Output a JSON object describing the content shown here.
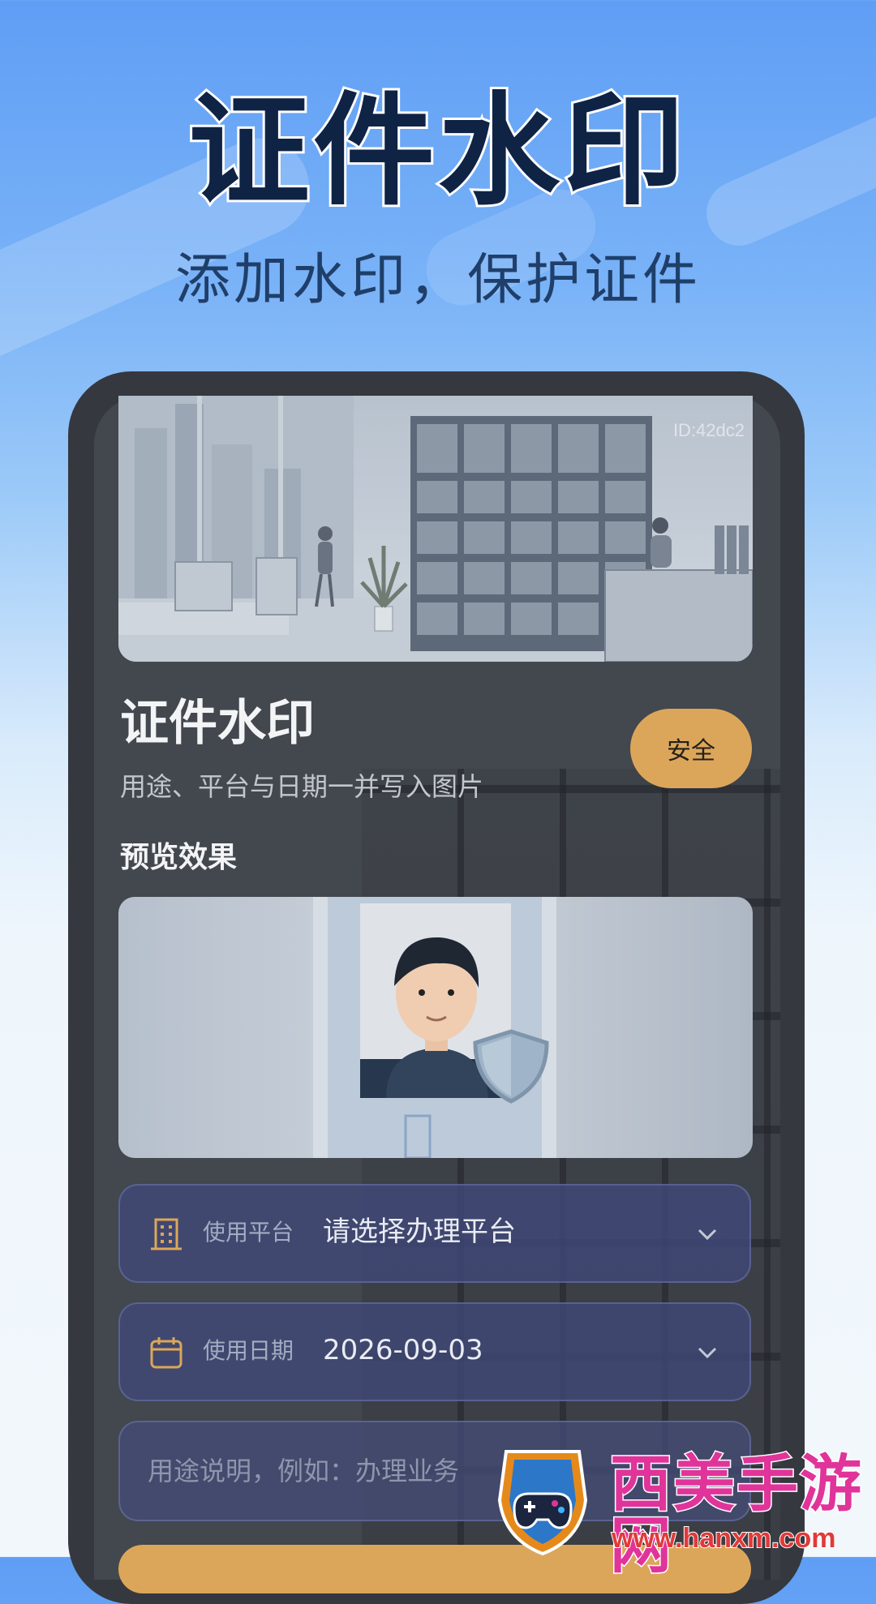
{
  "hero": {
    "title": "证件水印",
    "subtitle": "添加水印，保护证件"
  },
  "app": {
    "photo_id": "ID:42dc2",
    "card_title": "证件水印",
    "card_desc": "用途、平台与日期一并写入图片",
    "badge": "安全",
    "preview_label": "预览效果",
    "fields": {
      "platform": {
        "label": "使用平台",
        "value": "请选择办理平台",
        "icon": "building-icon"
      },
      "date": {
        "label": "使用日期",
        "value": "2026-09-03",
        "icon": "calendar-icon"
      },
      "purpose": {
        "placeholder": "用途说明，例如：办理业务"
      }
    }
  },
  "watermark": {
    "brand": "西美手游网",
    "url": "www.hanxm.com"
  },
  "colors": {
    "accent": "#dca65a",
    "title": "#0f2345",
    "field_bg": "#3f4878"
  }
}
